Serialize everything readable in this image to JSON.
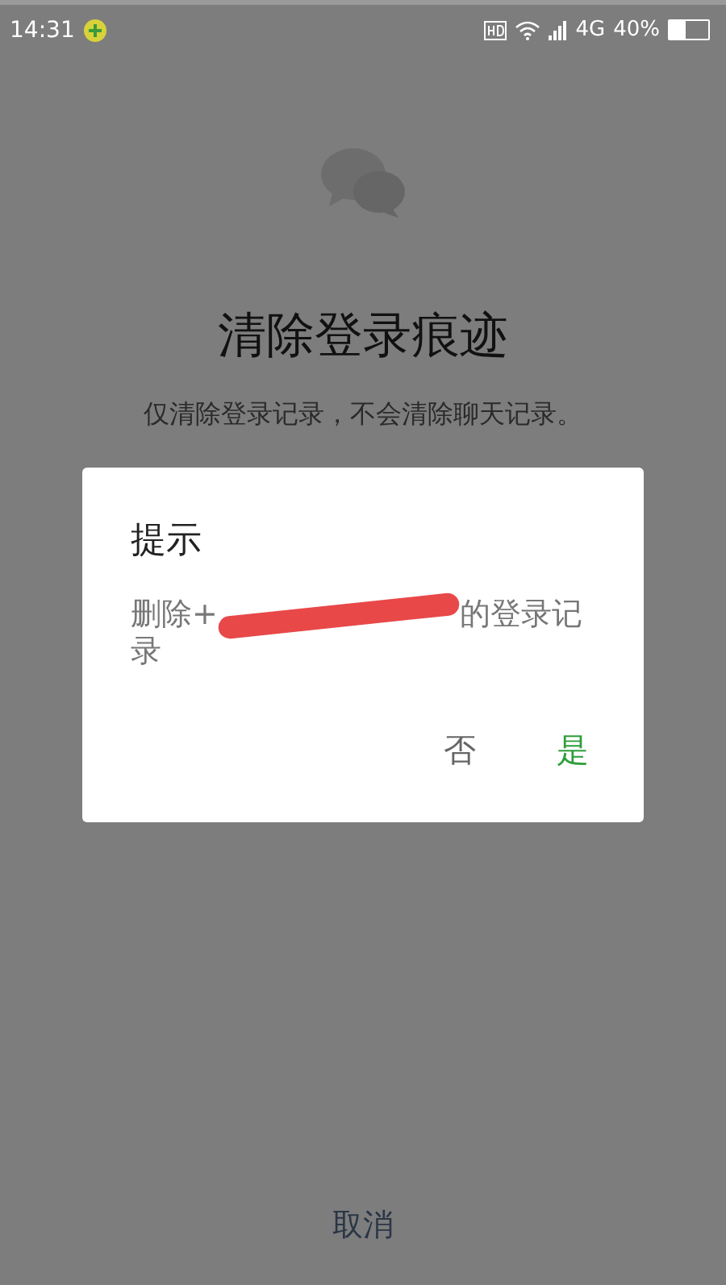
{
  "status_bar": {
    "time": "14:31",
    "network": "4G",
    "battery_text": "40%"
  },
  "page": {
    "title": "清除登录痕迹",
    "subtitle": "仅清除登录记录，不会清除聊天记录。",
    "cancel": "取消"
  },
  "dialog": {
    "title": "提示",
    "message_before": "删除+",
    "redacted": true,
    "message_after": "的登录记录",
    "buttons": [
      {
        "label": "否",
        "kind": "negative"
      },
      {
        "label": "是",
        "kind": "positive"
      }
    ]
  }
}
